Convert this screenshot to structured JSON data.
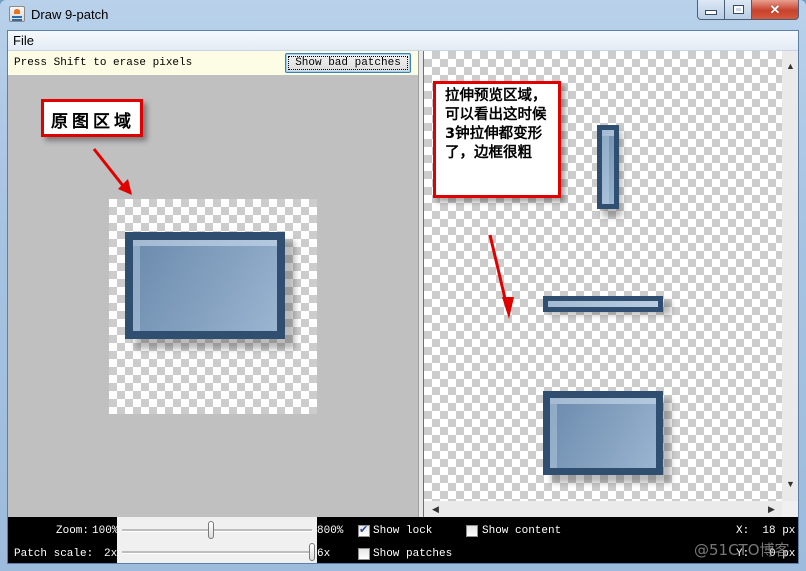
{
  "window": {
    "title": "Draw 9-patch",
    "controls": {
      "minimize": "minimize-icon",
      "maximize": "maximize-icon",
      "close": "close-icon"
    }
  },
  "menu": {
    "items": [
      "File"
    ]
  },
  "editor": {
    "hint": "Press Shift to erase pixels",
    "bad_patches_button": "Show bad patches"
  },
  "annotations": {
    "original_area": "原图区域",
    "preview_area": "拉伸预览区域，可以看出这时候3钟拉伸都变形了，边框很粗"
  },
  "controls": {
    "zoom_label": "Zoom:",
    "zoom_min": "100%",
    "zoom_max": "800%",
    "zoom_value_fraction": 0.47,
    "patch_scale_label": "Patch scale:",
    "patch_scale_min": "2x",
    "patch_scale_max": "6x",
    "patch_scale_value_fraction": 1.0,
    "show_lock": {
      "label": "Show lock",
      "checked": true
    },
    "show_patches": {
      "label": "Show patches",
      "checked": false
    },
    "show_content": {
      "label": "Show content",
      "checked": false
    },
    "x_readout": "X:  18 px",
    "y_readout": "Y:   0 px"
  },
  "colors": {
    "tile_border": "#2f4e70",
    "tile_fill": "#87a3c2",
    "annotation_red": "#e00000",
    "hint_bg": "#fdfde5"
  },
  "watermark": "@51CTO博客"
}
